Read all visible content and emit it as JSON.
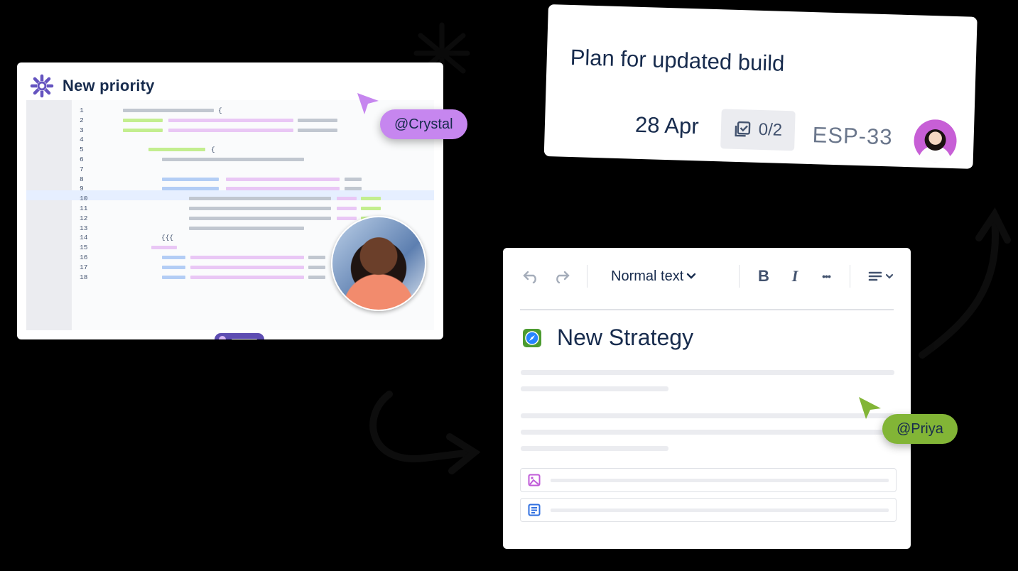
{
  "code_card": {
    "title": "New priority",
    "line_numbers": [
      "1",
      "2",
      "3",
      "4",
      "5",
      "6",
      "7",
      "8",
      "9",
      "10",
      "11",
      "12",
      "13",
      "14",
      "15",
      "16",
      "17",
      "18"
    ],
    "brace_open": "{",
    "brace_triple": "{{{"
  },
  "mentions": {
    "crystal": "@Crystal",
    "priya": "@Priya"
  },
  "task_card": {
    "title": "Plan for updated build",
    "date": "28 Apr",
    "checklist": "0/2",
    "issue_key": "ESP-33"
  },
  "editor": {
    "text_style": "Normal text",
    "bold_label": "B",
    "italic_label": "I",
    "more_label": "•••",
    "doc_title": "New Strategy"
  },
  "colors": {
    "crystal_tag": "#c686ef",
    "priya_tag": "#82b536",
    "brand_purple": "#5e4db2",
    "text_dark": "#172b4d"
  },
  "icons": [
    "atlassian-asterisk-icon",
    "undo-icon",
    "redo-icon",
    "chevron-down-icon",
    "align-icon",
    "checklist-icon",
    "compass-icon",
    "image-icon",
    "page-icon",
    "cursor-icon"
  ]
}
